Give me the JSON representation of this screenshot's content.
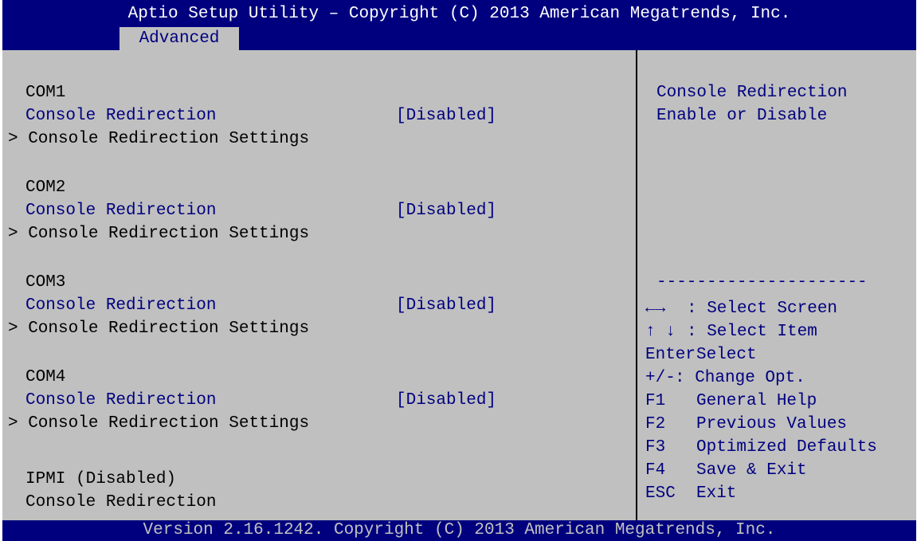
{
  "header": {
    "title": "Aptio Setup Utility – Copyright (C) 2013 American Megatrends, Inc.",
    "active_tab": "Advanced"
  },
  "main": {
    "groups": [
      {
        "heading": "COM1",
        "option_label": "Console Redirection",
        "option_value": "[Disabled]",
        "submenu": "> Console Redirection Settings"
      },
      {
        "heading": "COM2",
        "option_label": "Console Redirection",
        "option_value": "[Disabled]",
        "submenu": "> Console Redirection Settings"
      },
      {
        "heading": "COM3",
        "option_label": "Console Redirection",
        "option_value": "[Disabled]",
        "submenu": "> Console Redirection Settings"
      },
      {
        "heading": "COM4",
        "option_label": "Console Redirection",
        "option_value": "[Disabled]",
        "submenu": "> Console Redirection Settings"
      }
    ],
    "ipmi_heading": "IPMI (Disabled)",
    "ipmi_label": "Console Redirection"
  },
  "help": {
    "title": "Console Redirection",
    "description": "Enable or Disable",
    "separator": "---------------------",
    "keys": [
      {
        "key": "←→",
        "desc": ": Select Screen"
      },
      {
        "key": "↑ ↓",
        "desc": ": Select Item"
      },
      {
        "key": "Enter",
        "desc": "Select"
      },
      {
        "key": "+/-",
        "desc": ": Change Opt."
      },
      {
        "key": "F1",
        "desc": "General Help"
      },
      {
        "key": "F2",
        "desc": "Previous Values"
      },
      {
        "key": "F3",
        "desc": "Optimized Defaults"
      },
      {
        "key": "F4",
        "desc": "Save & Exit"
      },
      {
        "key": "ESC",
        "desc": "Exit"
      }
    ]
  },
  "footer": {
    "text": "Version 2.16.1242. Copyright (C) 2013 American Megatrends, Inc."
  },
  "colors": {
    "bar_background": "#00007f",
    "panel_background": "#c0c0c0",
    "highlight_text": "#00007f"
  }
}
